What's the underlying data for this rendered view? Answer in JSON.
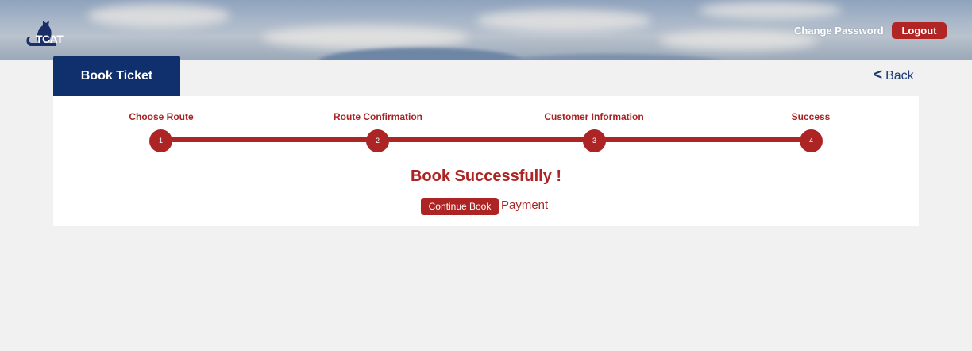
{
  "header": {
    "logo_text": "TCAT",
    "change_password_label": "Change Password",
    "logout_label": "Logout"
  },
  "tabs": {
    "active_label": "Book Ticket"
  },
  "back": {
    "label": "Back",
    "chevron": "<"
  },
  "steps": [
    {
      "label": "Choose Route",
      "number": "1"
    },
    {
      "label": "Route Confirmation",
      "number": "2"
    },
    {
      "label": "Customer Information",
      "number": "3"
    },
    {
      "label": "Success",
      "number": "4"
    }
  ],
  "result": {
    "title": "Book Successfully !",
    "continue_label": "Continue Book",
    "payment_label": "Payment"
  },
  "colors": {
    "accent_red": "#ad2424",
    "tab_navy": "#0f2f6d",
    "background": "#f1f1f1"
  }
}
